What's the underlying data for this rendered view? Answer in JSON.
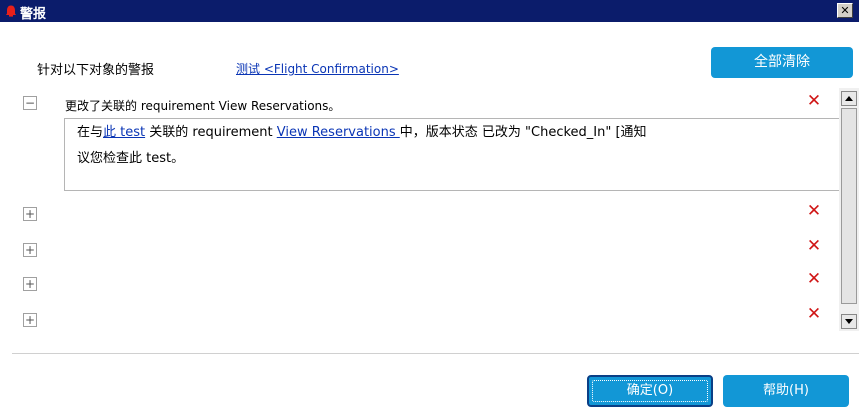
{
  "window": {
    "title": "警报",
    "close_glyph": "✕"
  },
  "header": {
    "alerts_for_label": "针对以下对象的警报",
    "test_link": "测试 <Flight Confirmation>",
    "clear_all_label": "全部清除"
  },
  "alerts": [
    {
      "expanded": true,
      "expander_glyph": "−",
      "summary": "更改了关联的 requirement View Reservations。",
      "detail": {
        "prefix": "在与",
        "test_link": "此 test",
        "middle": " 关联的 requirement ",
        "req_link": "View Reservations ",
        "suffix": "中，版本状态 已改为 \"Checked_In\" [通知",
        "line2": "议您检查此 test。"
      },
      "delete_glyph": "✕"
    },
    {
      "expanded": false,
      "expander_glyph": "+",
      "delete_glyph": "✕"
    },
    {
      "expanded": false,
      "expander_glyph": "+",
      "delete_glyph": "✕"
    },
    {
      "expanded": false,
      "expander_glyph": "+",
      "delete_glyph": "✕"
    },
    {
      "expanded": false,
      "expander_glyph": "+",
      "delete_glyph": "✕"
    }
  ],
  "footer": {
    "ok_label": "确定(O)",
    "help_label": "帮助(H)"
  },
  "colors": {
    "title_bar": "#0b1c6b",
    "button_blue": "#1297d6",
    "link_blue": "#0a35b5",
    "delete_red": "#d01616"
  },
  "icons": {
    "title_icon": "alert-bell-icon",
    "close": "close-icon",
    "expand": "expand-plus-icon",
    "collapse": "collapse-minus-icon",
    "delete": "delete-x-icon"
  }
}
